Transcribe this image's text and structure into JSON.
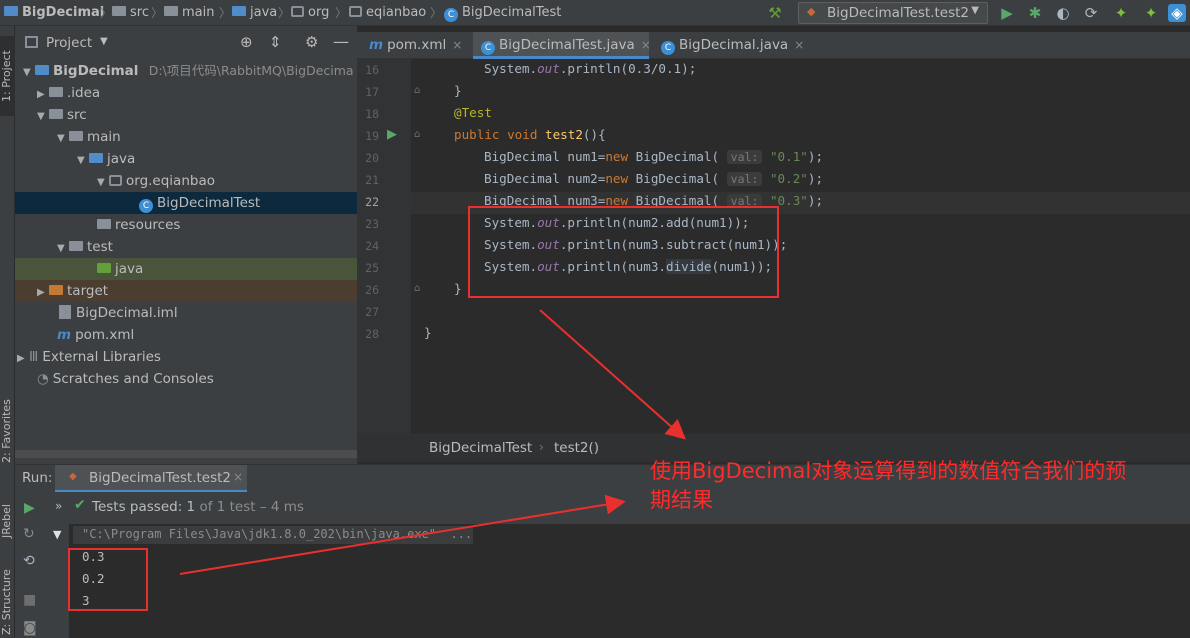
{
  "navbar": {
    "crumbs": [
      "BigDecimal",
      "src",
      "main",
      "java",
      "org",
      "eqianbao",
      "BigDecimalTest"
    ],
    "run_config": "BigDecimalTest.test2"
  },
  "side_stripe": {
    "project_tab": "1: Project",
    "favorites_tab": "2: Favorites",
    "rebel_tab": "JRebel",
    "structure_tab": "Z: Structure"
  },
  "project_panel": {
    "title": "Project",
    "tree": [
      {
        "label": "BigDecimal",
        "path": "D:\\项目代码\\RabbitMQ\\BigDecima"
      },
      {
        "label": ".idea"
      },
      {
        "label": "src"
      },
      {
        "label": "main"
      },
      {
        "label": "java"
      },
      {
        "label": "org.eqianbao"
      },
      {
        "label": "BigDecimalTest"
      },
      {
        "label": "resources"
      },
      {
        "label": "test"
      },
      {
        "label": "java"
      },
      {
        "label": "target"
      },
      {
        "label": "BigDecimal.iml"
      },
      {
        "label": "pom.xml"
      },
      {
        "label": "External Libraries"
      },
      {
        "label": "Scratches and Consoles"
      }
    ]
  },
  "editor": {
    "tabs": [
      {
        "label": "pom.xml"
      },
      {
        "label": "BigDecimalTest.java"
      },
      {
        "label": "BigDecimal.java"
      }
    ],
    "line_numbers": [
      "16",
      "17",
      "18",
      "19",
      "20",
      "21",
      "22",
      "23",
      "24",
      "25",
      "26",
      "27",
      "28"
    ],
    "code": {
      "l16_a": "System.",
      "l16_b": "out",
      "l16_c": ".println(0.3/0.1);",
      "l17": "}",
      "l18": "@Test",
      "l19_kw": "public void ",
      "l19_fn": "test2",
      "l19_rest": "(){",
      "l20_a": "BigDecimal num1=",
      "l20_kw": "new ",
      "l20_b": "BigDecimal(",
      "l20_hint": "val:",
      "l20_str": "\"0.1\"",
      "l20_end": ");",
      "l21_a": "BigDecimal num2=",
      "l21_kw": "new ",
      "l21_b": "BigDecimal(",
      "l21_hint": "val:",
      "l21_str": "\"0.2\"",
      "l21_end": ");",
      "l22_a": "BigDecimal num3=",
      "l22_kw": "new ",
      "l22_b": "BigDecimal(",
      "l22_hint": "val:",
      "l22_str": "\"0.3\"",
      "l22_end": ");",
      "l23_a": "System.",
      "l23_b": "out",
      "l23_c": ".println(num2.add(num1));",
      "l24_a": "System.",
      "l24_b": "out",
      "l24_c": ".println(num3.subtract(num1));",
      "l25_a": "System.",
      "l25_b": "out",
      "l25_c": ".println(num3.",
      "l25_d": "divide",
      "l25_e": "(num1));",
      "l26": "}",
      "l28": "}"
    },
    "breadcrumb": [
      "BigDecimalTest",
      "test2()"
    ]
  },
  "run_panel": {
    "label": "Run:",
    "tab": "BigDecimalTest.test2",
    "tests_passed": "Tests passed:",
    "tests_count": "1",
    "tests_of": "of 1 test – 4 ms",
    "command": "\"C:\\Program Files\\Java\\jdk1.8.0_202\\bin\\java.exe\"  ...",
    "output": [
      "0.3",
      "0.2",
      "3"
    ]
  },
  "annotation": {
    "text_line1": "使用BigDecimal对象运算得到的数值符合我们的预",
    "text_line2": "期结果"
  },
  "colors": {
    "annotation_red": "#e8302f",
    "selection_blue": "#0d293e",
    "accent_blue": "#4a88c7"
  }
}
